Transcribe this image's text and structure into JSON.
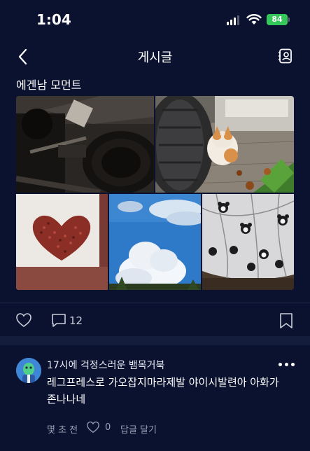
{
  "status_bar": {
    "time": "1:04",
    "battery": "84"
  },
  "header": {
    "title": "게시글"
  },
  "post": {
    "title": "에겐남 모먼트",
    "comment_count": "12"
  },
  "comment": {
    "author": "17시에 걱정스러운 뱀목거북",
    "body": "레그프레스로 가오잡지마라제발 야이시발련아 아화가존나나네",
    "time_ago": "몇 초 전",
    "like_count": "0",
    "reply_label": "답글 달기"
  },
  "colors": {
    "background": "#0b1230",
    "battery": "#34c759",
    "muted": "#9aa1b5"
  }
}
